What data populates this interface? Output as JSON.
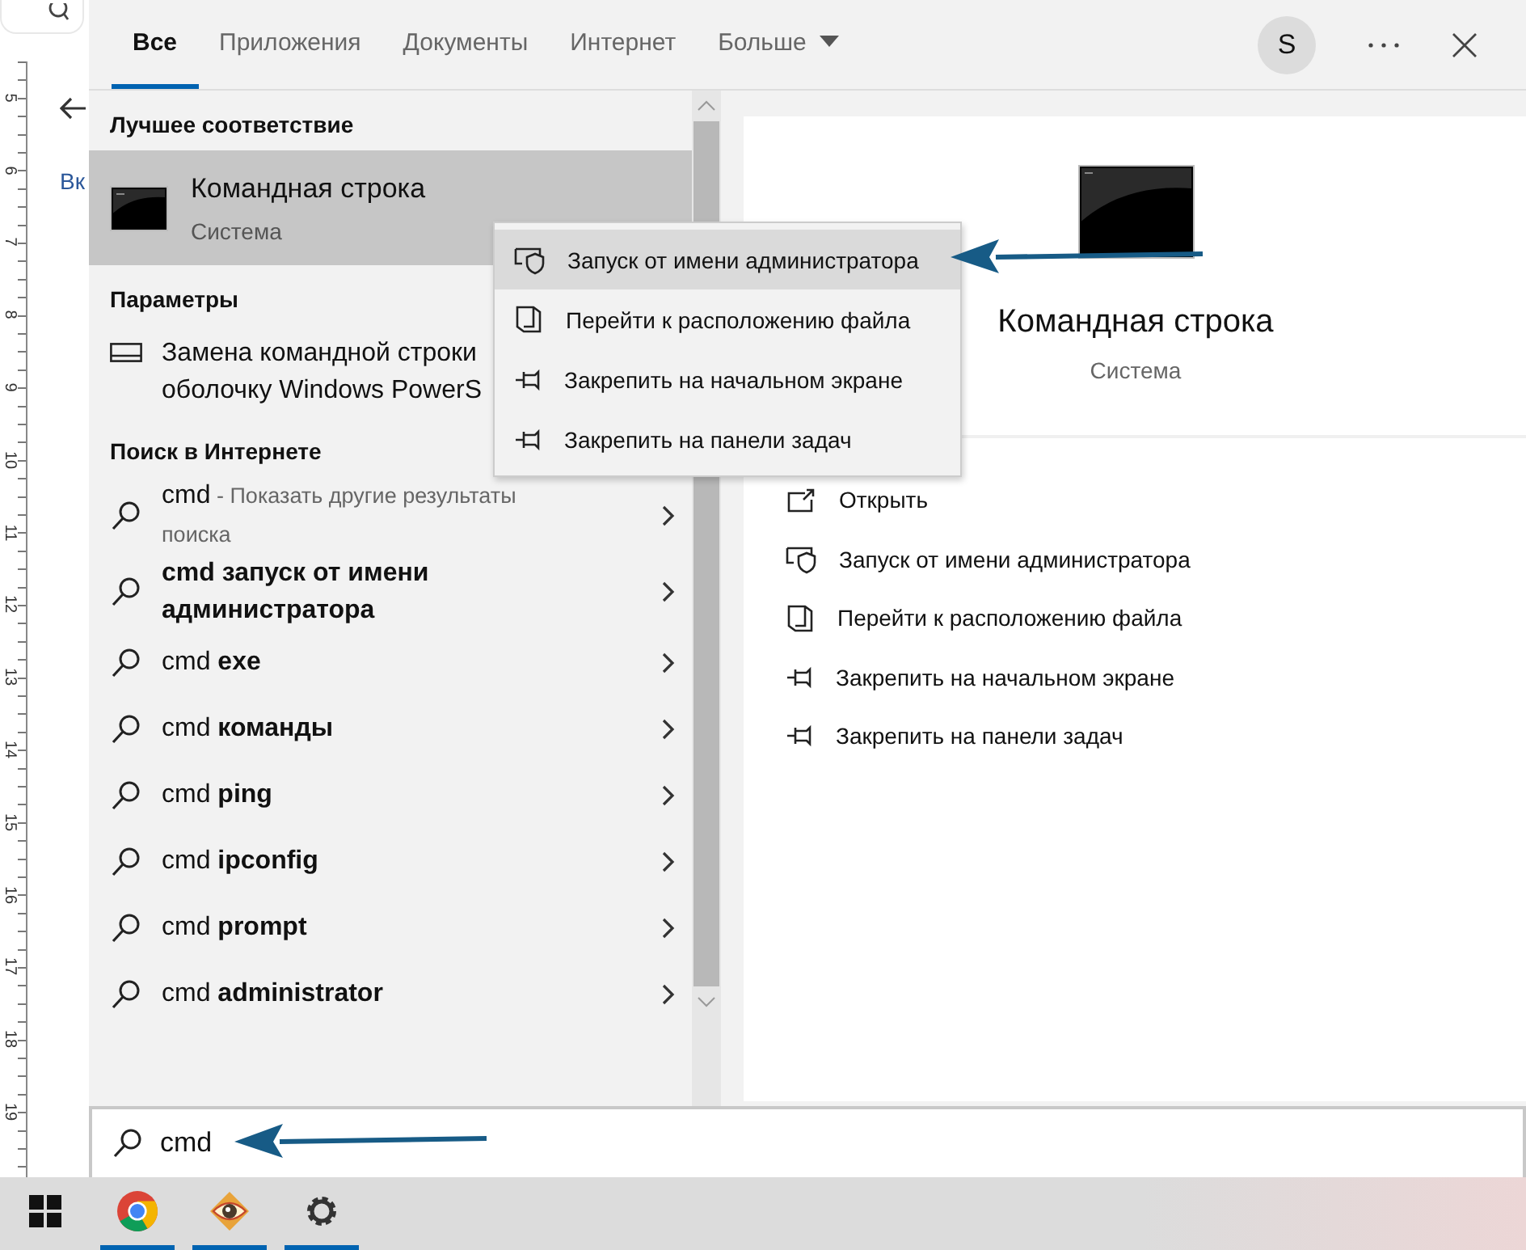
{
  "background": {
    "ruler_labels": [
      "5",
      "6",
      "7",
      "8",
      "9",
      "10",
      "11",
      "12",
      "13",
      "14",
      "15",
      "16",
      "17",
      "18",
      "19"
    ],
    "partial_text": "Вк"
  },
  "tabs": [
    {
      "label": "Все",
      "selected": true
    },
    {
      "label": "Приложения",
      "selected": false
    },
    {
      "label": "Документы",
      "selected": false
    },
    {
      "label": "Интернет",
      "selected": false
    },
    {
      "label": "Больше",
      "selected": false,
      "kind": "dropdown"
    }
  ],
  "account": {
    "initial": "S"
  },
  "results": {
    "best_match": {
      "header": "Лучшее соответствие",
      "title": "Командная строка",
      "subtitle": "Система",
      "selected": true
    },
    "settings": {
      "header": "Параметры",
      "lines": [
        "Замена командной строки",
        "оболочку Windows PowerS"
      ]
    },
    "web": {
      "header": "Поиск в Интернете",
      "items": [
        {
          "kind": "more",
          "text": "cmd",
          "note": "- Показать другие результаты поиска"
        },
        {
          "kind": "completion",
          "text": "**cmd запуск от имени администратора**"
        },
        {
          "kind": "completion",
          "text": "cmd **exe**"
        },
        {
          "kind": "completion",
          "text": "cmd **команды**"
        },
        {
          "kind": "completion",
          "text": "cmd **ping**"
        },
        {
          "kind": "completion",
          "text": "cmd **ipconfig**"
        },
        {
          "kind": "completion",
          "text": "cmd **prompt**"
        },
        {
          "kind": "completion",
          "text": "cmd **administrator**"
        }
      ]
    }
  },
  "context_menu": [
    {
      "kind": "admin",
      "label": "Запуск от имени администратора",
      "selected": true
    },
    {
      "kind": "location",
      "label": "Перейти к расположению файла",
      "selected": false
    },
    {
      "kind": "pin",
      "label": "Закрепить на начальном экране",
      "selected": false
    },
    {
      "kind": "pin",
      "label": "Закрепить на панели задач",
      "selected": false
    }
  ],
  "preview": {
    "title": "Командная строка",
    "subtitle": "Система",
    "actions": [
      {
        "kind": "open",
        "label": "Открыть"
      },
      {
        "kind": "admin",
        "label": "Запуск от имени администратора"
      },
      {
        "kind": "location",
        "label": "Перейти к расположению файла"
      },
      {
        "kind": "pin",
        "label": "Закрепить на начальном экране"
      },
      {
        "kind": "pin",
        "label": "Закрепить на панели задач"
      }
    ]
  },
  "search": {
    "value": "cmd"
  },
  "taskbar": [
    {
      "kind": "start",
      "running": false
    },
    {
      "kind": "browser",
      "running": true
    },
    {
      "kind": "eye",
      "running": true
    },
    {
      "kind": "settings",
      "running": true
    }
  ]
}
